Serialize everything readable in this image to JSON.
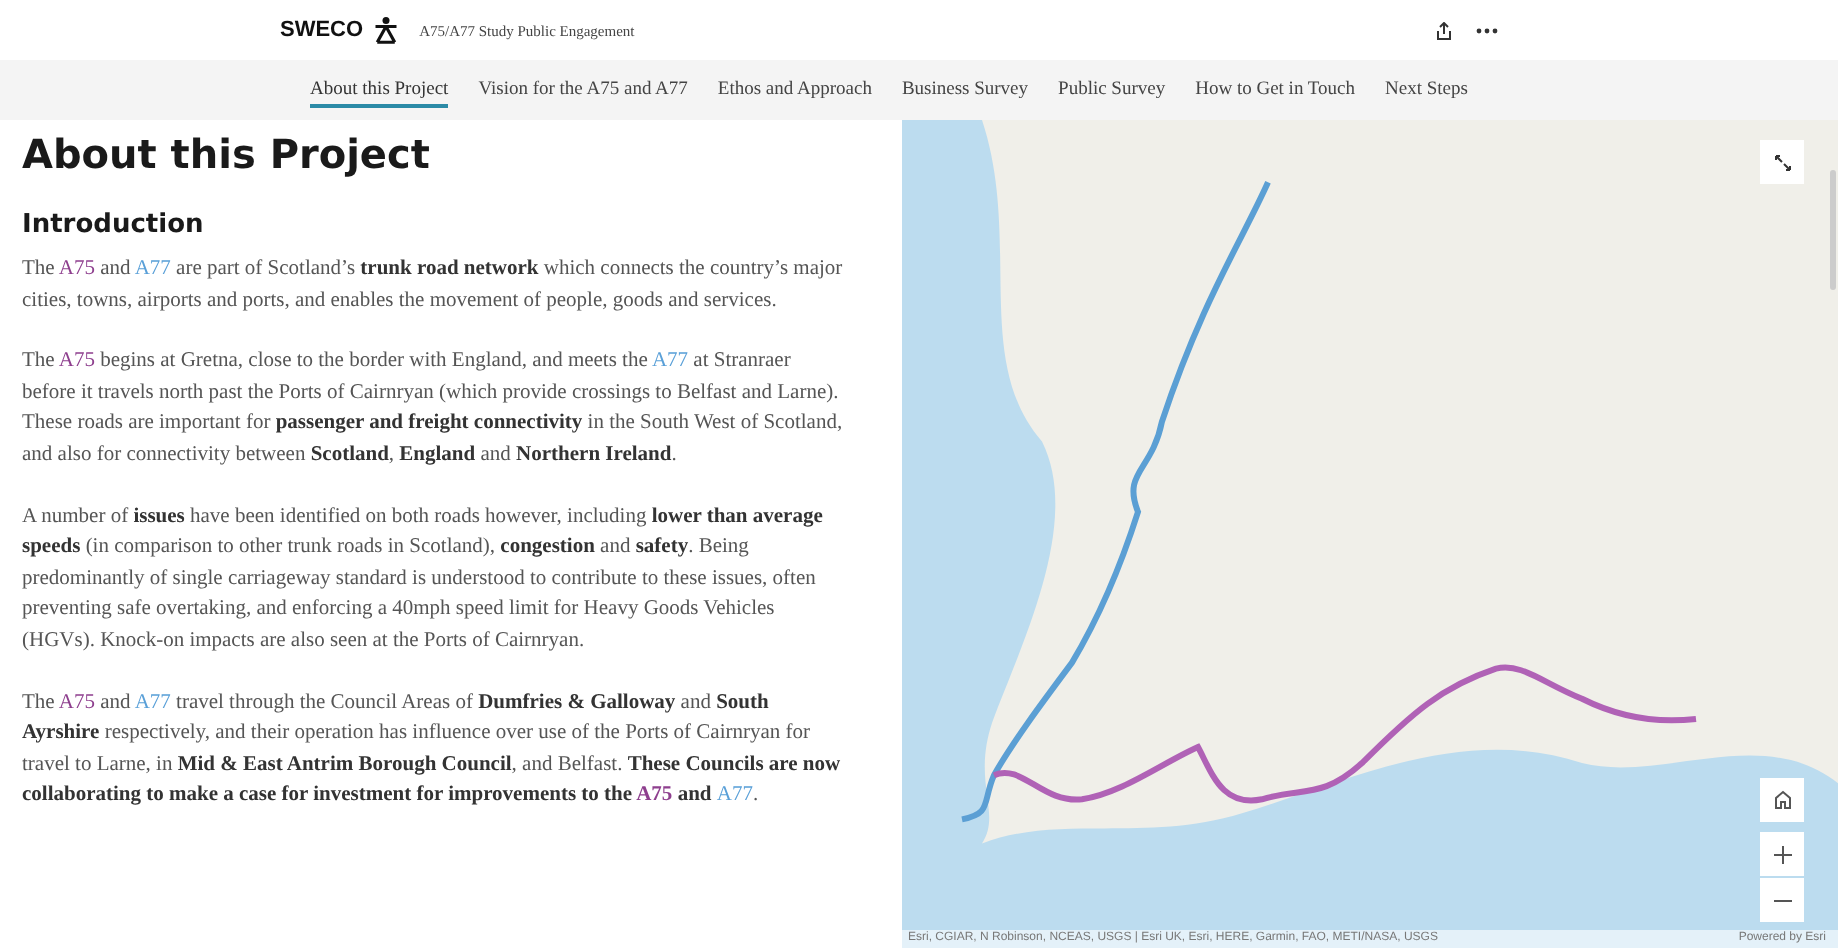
{
  "header": {
    "logo": "SWECO",
    "title": "A75/A77 Study Public Engagement"
  },
  "nav": [
    {
      "label": "About this Project",
      "selected": true
    },
    {
      "label": "Vision for the A75 and A77",
      "selected": false
    },
    {
      "label": "Ethos and Approach",
      "selected": false
    },
    {
      "label": "Business Survey",
      "selected": false
    },
    {
      "label": "Public Survey",
      "selected": false
    },
    {
      "label": "How to Get in Touch",
      "selected": false
    },
    {
      "label": "Next Steps",
      "selected": false
    }
  ],
  "page_title": "About this Project",
  "section_title": "Introduction",
  "paragraphs": [
    [
      {
        "kind": "plain",
        "text": "The "
      },
      {
        "kind": "a75",
        "text": "A75"
      },
      {
        "kind": "plain",
        "text": " and "
      },
      {
        "kind": "a77",
        "text": "A77"
      },
      {
        "kind": "plain",
        "text": " are part of Scotland’s "
      },
      {
        "kind": "bold",
        "text": "trunk road network"
      },
      {
        "kind": "plain",
        "text": " which connects the country’s major cities, towns, airports and ports, and enables the movement of people, goods and services."
      }
    ],
    [
      {
        "kind": "plain",
        "text": "The "
      },
      {
        "kind": "a75",
        "text": "A75"
      },
      {
        "kind": "plain",
        "text": " begins at Gretna, close to the border with England, and meets the "
      },
      {
        "kind": "a77",
        "text": "A77"
      },
      {
        "kind": "plain",
        "text": " at Stranraer before it travels north past the Ports of Cairnryan (which provide crossings to Belfast and Larne). These roads are important for "
      },
      {
        "kind": "bold",
        "text": "passenger and freight connectivity"
      },
      {
        "kind": "plain",
        "text": " in the South West of Scotland, and also for connectivity between "
      },
      {
        "kind": "bold",
        "text": "Scotland"
      },
      {
        "kind": "plain",
        "text": ", "
      },
      {
        "kind": "bold",
        "text": "England"
      },
      {
        "kind": "plain",
        "text": " and "
      },
      {
        "kind": "bold",
        "text": "Northern Ireland"
      },
      {
        "kind": "plain",
        "text": "."
      }
    ],
    [
      {
        "kind": "plain",
        "text": "A number of "
      },
      {
        "kind": "bold",
        "text": "issues"
      },
      {
        "kind": "plain",
        "text": " have been identified on both roads however, including "
      },
      {
        "kind": "bold",
        "text": "lower than average speeds"
      },
      {
        "kind": "plain",
        "text": " (in comparison to other trunk roads in Scotland), "
      },
      {
        "kind": "bold",
        "text": "congestion"
      },
      {
        "kind": "plain",
        "text": " and "
      },
      {
        "kind": "bold",
        "text": "safety"
      },
      {
        "kind": "plain",
        "text": ". Being predominantly of single carriageway standard is understood to contribute to these issues, often preventing safe overtaking, and enforcing a 40mph speed limit for Heavy Goods Vehicles (HGVs). Knock-on impacts are also seen at the Ports of Cairnryan."
      }
    ],
    [
      {
        "kind": "plain",
        "text": "The "
      },
      {
        "kind": "a75",
        "text": "A75"
      },
      {
        "kind": "plain",
        "text": " and "
      },
      {
        "kind": "a77",
        "text": "A77"
      },
      {
        "kind": "plain",
        "text": " travel through the Council Areas of "
      },
      {
        "kind": "bold",
        "text": "Dumfries & Galloway"
      },
      {
        "kind": "plain",
        "text": " and "
      },
      {
        "kind": "bold",
        "text": "South Ayrshire"
      },
      {
        "kind": "plain",
        "text": " respectively, and their operation has influence over use of the Ports of Cairnryan for travel to Larne, in "
      },
      {
        "kind": "bold",
        "text": "Mid & East Antrim Borough Council"
      },
      {
        "kind": "plain",
        "text": ", and Belfast. "
      },
      {
        "kind": "bold",
        "text": "These Councils are now collaborating to make a case for investment for improvements to the "
      },
      {
        "kind": "a75b",
        "text": "A75"
      },
      {
        "kind": "bold",
        "text": " and "
      },
      {
        "kind": "a77",
        "text": "A77"
      },
      {
        "kind": "plain",
        "text": "."
      }
    ]
  ],
  "map": {
    "attribution": "Esri, CGIAR, N Robinson, NCEAS, USGS | Esri UK, Esri, HERE, Garmin, FAO, METI/NASA, USGS",
    "powered_by": "Powered by Esri"
  }
}
